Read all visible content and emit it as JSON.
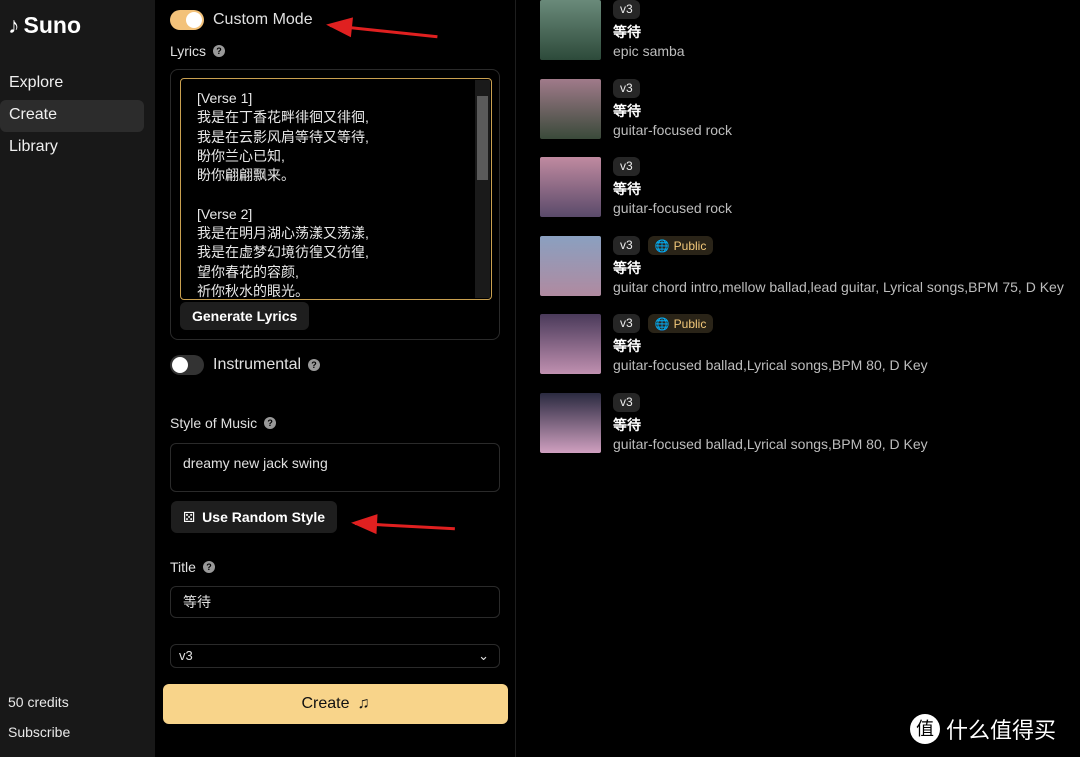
{
  "sidebar": {
    "logo": "Suno",
    "nav": [
      {
        "label": "Explore"
      },
      {
        "label": "Create",
        "active": true
      },
      {
        "label": "Library"
      }
    ],
    "credits": "50 credits",
    "subscribe": "Subscribe"
  },
  "form": {
    "custom_mode_label": "Custom Mode",
    "custom_mode_on": true,
    "lyrics_label": "Lyrics",
    "lyrics_value": "[Verse 1]\n我是在丁香花畔徘徊又徘徊,\n我是在云影风肩等待又等待,\n盼你兰心已知,\n盼你翩翩飘来。\n\n[Verse 2]\n我是在明月湖心荡漾又荡漾,\n我是在虚梦幻境彷徨又彷徨,\n望你春花的容颜,\n祈你秋水的眼光。",
    "generate_lyrics": "Generate Lyrics",
    "instrumental_label": "Instrumental",
    "instrumental_on": false,
    "style_label": "Style of Music",
    "style_value": "dreamy new jack swing",
    "random_style": "Use Random Style",
    "title_label": "Title",
    "title_value": "等待",
    "version": "v3",
    "create": "Create"
  },
  "songs": [
    {
      "version": "v3",
      "public": false,
      "title": "等待",
      "desc": "epic samba",
      "colors": [
        "#6a8a7a",
        "#2d4a3a"
      ]
    },
    {
      "version": "v3",
      "public": false,
      "title": "等待",
      "desc": "guitar-focused rock",
      "colors": [
        "#a07a8a",
        "#3a4a3a"
      ]
    },
    {
      "version": "v3",
      "public": false,
      "title": "等待",
      "desc": "guitar-focused rock",
      "colors": [
        "#c08aa0",
        "#5a4a6a"
      ]
    },
    {
      "version": "v3",
      "public": true,
      "public_label": "Public",
      "title": "等待",
      "desc": "guitar chord intro,mellow ballad,lead guitar, Lyrical songs,BPM 75, D Key",
      "colors": [
        "#8aa0c0",
        "#b08aa0"
      ]
    },
    {
      "version": "v3",
      "public": true,
      "public_label": "Public",
      "title": "等待",
      "desc": "guitar-focused ballad,Lyrical songs,BPM 80, D Key",
      "colors": [
        "#4a3a5a",
        "#c090b0"
      ]
    },
    {
      "version": "v3",
      "public": false,
      "title": "等待",
      "desc": "guitar-focused ballad,Lyrical songs,BPM 80, D Key",
      "colors": [
        "#2a2a40",
        "#d0a0c0"
      ]
    }
  ],
  "watermark": {
    "logo": "值",
    "text": "什么值得买"
  },
  "colors": {
    "accent": "#f8d48a",
    "annotation_arrow": "#e02020"
  }
}
